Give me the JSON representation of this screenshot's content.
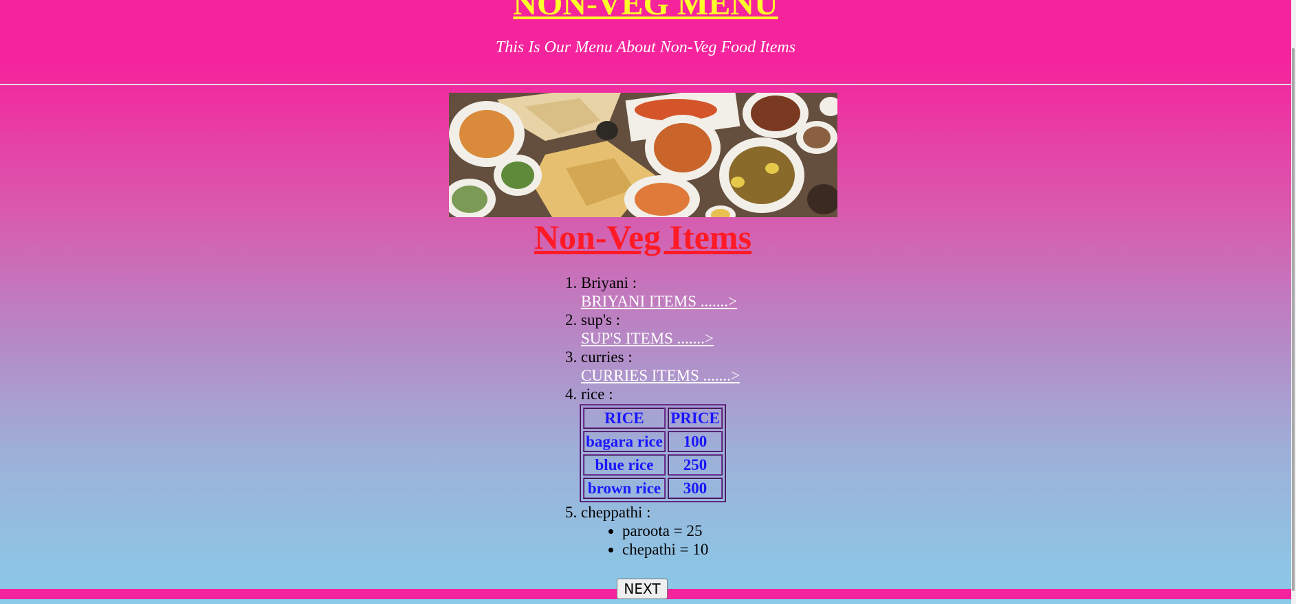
{
  "header": {
    "title": "NON-VEG MENU",
    "subtitle": "This Is Our Menu About Non-Veg Food Items"
  },
  "hero_image": {
    "description_icon": "food-platter-image"
  },
  "section": {
    "title": "Non-Veg Items"
  },
  "menu": {
    "items": [
      {
        "label": "Briyani :",
        "link": "BRIYANI ITEMS .......>"
      },
      {
        "label": "sup's :",
        "link": "SUP'S ITEMS .......>"
      },
      {
        "label": "curries :",
        "link": "CURRIES ITEMS .......>"
      },
      {
        "label": "rice :"
      },
      {
        "label": "cheppathi :"
      }
    ],
    "rice_table": {
      "headers": [
        "RICE",
        "PRICE"
      ],
      "rows": [
        [
          "bagara rice",
          "100"
        ],
        [
          "blue rice",
          "250"
        ],
        [
          "brown rice",
          "300"
        ]
      ]
    },
    "cheppathi_list": [
      "paroota = 25",
      "chepathi = 10"
    ]
  },
  "button": {
    "next_label": "NEXT"
  },
  "colors": {
    "header_bg": "#f5239c",
    "title": "#ffff2a",
    "section_title": "#ff1a25",
    "table_text": "#1a16ff",
    "gradient_bottom": "#89cbe8"
  }
}
